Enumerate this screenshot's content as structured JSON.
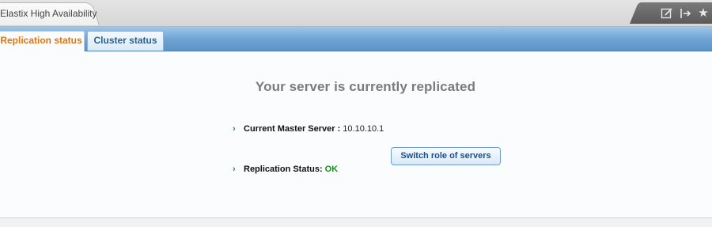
{
  "browser": {
    "tab_title": "Elastix High Availability",
    "toolbar_icons": [
      "edit-icon",
      "exit-icon",
      "star-icon"
    ],
    "star_glyph": "★"
  },
  "app": {
    "tabs": [
      {
        "label": "Replication status",
        "active": true
      },
      {
        "label": "Cluster status",
        "active": false
      }
    ],
    "headline": "Your server is currently replicated",
    "master_server": {
      "label": "Current Master Server :",
      "value": "10.10.10.1"
    },
    "switch_button_label": "Switch role of servers",
    "replication_status": {
      "label": "Replication Status:",
      "value": "OK"
    },
    "bullet_glyph": "›"
  },
  "colors": {
    "active_tab_text": "#e2740b",
    "tabbar_blue": "#6da2d3",
    "status_ok": "#1a8f1a",
    "headline_gray": "#7b7b7b"
  }
}
